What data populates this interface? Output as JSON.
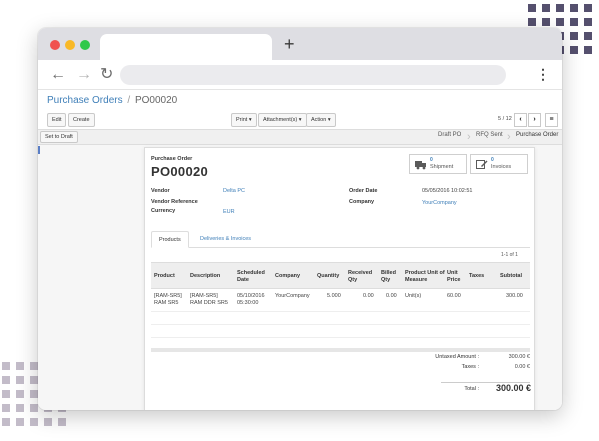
{
  "breadcrumb": {
    "parent": "Purchase Orders",
    "separator": "/",
    "current": "PO00020"
  },
  "toolbar": {
    "edit": "Edit",
    "create": "Create",
    "print": "Print ▾",
    "attachments": "Attachment(s) ▾",
    "action": "Action ▾",
    "pager": "5 / 12",
    "prev": "‹",
    "next": "›",
    "menu": "≡"
  },
  "status": {
    "set_to_draft": "Set to Draft",
    "stages": [
      "Draft PO",
      "RFQ Sent",
      "Purchase Order"
    ],
    "active_stage": "Purchase Order"
  },
  "order": {
    "kind": "Purchase Order",
    "name": "PO00020"
  },
  "smart_buttons": {
    "shipment": {
      "count": "0",
      "label": "Shipment",
      "icon": "truck-icon"
    },
    "invoices": {
      "count": "0",
      "label": "Invoices",
      "icon": "edit-icon"
    }
  },
  "fields": {
    "vendor_label": "Vendor",
    "vendor_value": "Delta PC",
    "vendor_ref_label": "Vendor Reference",
    "currency_label": "Currency",
    "currency_value": "EUR",
    "order_date_label": "Order Date",
    "order_date_value": "05/05/2016 10:02:51",
    "company_label": "Company",
    "company_value": "YourCompany"
  },
  "tabs": [
    "Products",
    "Deliveries & Invoices"
  ],
  "records": "1-1 of 1",
  "lines": {
    "headers": {
      "product": "Product",
      "description": "Description",
      "scheduled_date": "Scheduled Date",
      "company": "Company",
      "quantity": "Quantity",
      "received_qty": "Received Qty",
      "billed_qty": "Billed Qty",
      "uom": "Product Unit of Measure",
      "unit_price": "Unit Price",
      "taxes": "Taxes",
      "subtotal": "Subtotal"
    },
    "rows": [
      {
        "product_1": "[RAM-SR5]",
        "product_2": "RAM SR5",
        "description_1": "[RAM-SR5]",
        "description_2": "RAM DDR SR5",
        "date_1": "05/10/2016",
        "date_2": "05:30:00",
        "company": "YourCompany",
        "quantity": "5.000",
        "received": "0.00",
        "billed": "0.00",
        "uom": "Unit(s)",
        "unit_price": "60.00",
        "taxes": "",
        "subtotal": "300.00"
      }
    ]
  },
  "totals": {
    "untaxed_label": "Untaxed Amount :",
    "untaxed_value": "300.00 €",
    "taxes_label": "Taxes :",
    "taxes_value": "0.00 €",
    "total_label": "Total :",
    "total_value": "300.00 €"
  },
  "colors": {
    "link": "#3f7fb8",
    "accent_dots": "#55506e",
    "light_dots": "#c3bcc9"
  }
}
